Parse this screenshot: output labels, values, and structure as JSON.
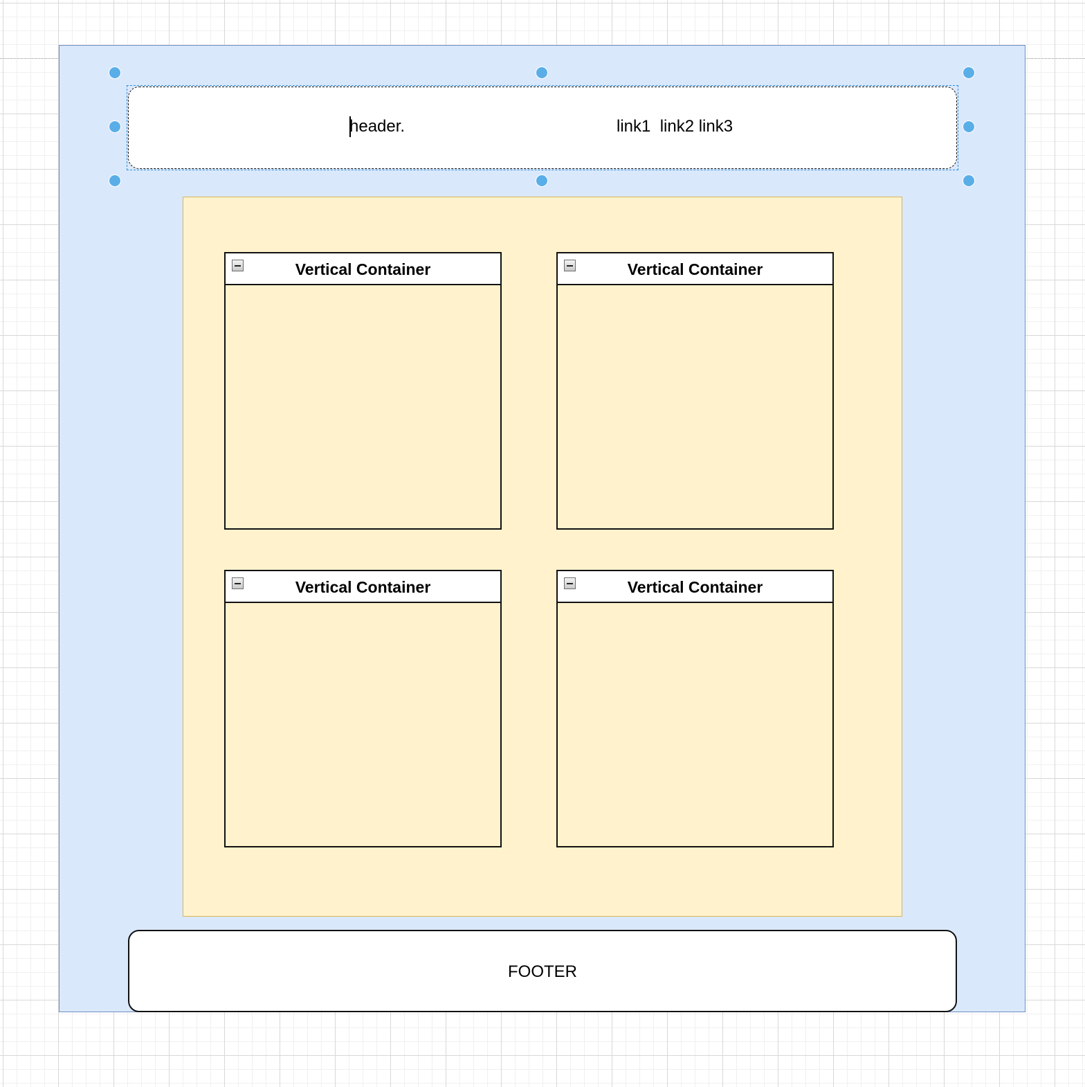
{
  "canvas": {
    "grid": true
  },
  "header": {
    "title": "header.",
    "links": "link1  link2 link3",
    "selected": true,
    "editing_text": true
  },
  "content": {
    "containers": [
      {
        "label": "Vertical Container",
        "collapse_icon": "collapse-minus-icon"
      },
      {
        "label": "Vertical Container",
        "collapse_icon": "collapse-minus-icon"
      },
      {
        "label": "Vertical Container",
        "collapse_icon": "collapse-minus-icon"
      },
      {
        "label": "Vertical Container",
        "collapse_icon": "collapse-minus-icon"
      }
    ]
  },
  "footer": {
    "label": "FOOTER"
  },
  "colors": {
    "outer_fill": "#dae8fc",
    "outer_stroke": "#6c8ebf",
    "content_fill": "#fff2cc",
    "content_stroke": "#d6b656",
    "handle": "#5aaee8"
  }
}
